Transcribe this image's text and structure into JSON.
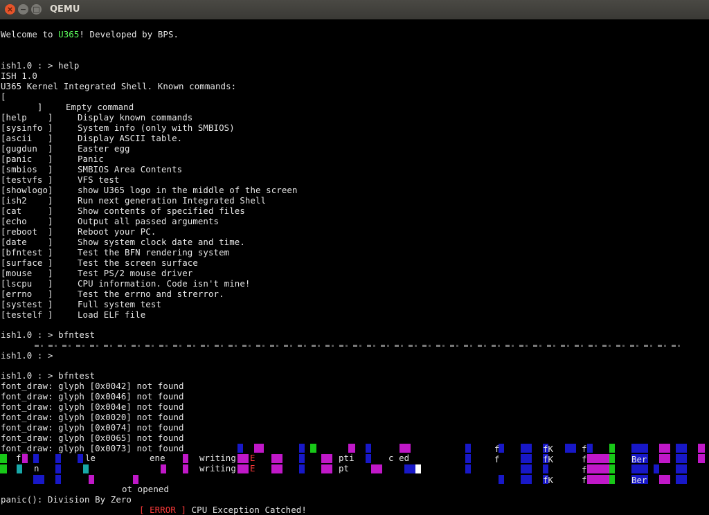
{
  "window": {
    "title": "QEMU"
  },
  "console": {
    "welcome": {
      "prefix": "Welcome to ",
      "brand": "U365",
      "suffix": "! Developed by BPS."
    },
    "prompt1": "ish1.0 : > help",
    "help_header": [
      "ISH 1.0",
      "U365 Kernel Integrated Shell. Known commands:"
    ],
    "empty_cmd": {
      "bracket_open": "[",
      "bracket_close": "       ]",
      "desc": "Empty command"
    },
    "commands": [
      {
        "cmd": "[help    ]",
        "desc": "Display known commands"
      },
      {
        "cmd": "[sysinfo ]",
        "desc": "System info (only with SMBIOS)"
      },
      {
        "cmd": "[ascii   ]",
        "desc": "Display ASCII table."
      },
      {
        "cmd": "[gugdun  ]",
        "desc": "Easter egg"
      },
      {
        "cmd": "[panic   ]",
        "desc": "Panic"
      },
      {
        "cmd": "[smbios  ]",
        "desc": "SMBIOS Area Contents"
      },
      {
        "cmd": "[testvfs ]",
        "desc": "VFS test"
      },
      {
        "cmd": "[showlogo]",
        "desc": "show U365 logo in the middle of the screen"
      },
      {
        "cmd": "[ish2    ]",
        "desc": "Run next generation Integrated Shell"
      },
      {
        "cmd": "[cat     ]",
        "desc": "Show contents of specified files"
      },
      {
        "cmd": "[echo    ]",
        "desc": "Output all passed arguments"
      },
      {
        "cmd": "[reboot  ]",
        "desc": "Reboot your PC."
      },
      {
        "cmd": "[date    ]",
        "desc": "Show system clock date and time."
      },
      {
        "cmd": "[bfntest ]",
        "desc": "Test the BFN rendering system"
      },
      {
        "cmd": "[surface ]",
        "desc": "Test the screen surface"
      },
      {
        "cmd": "[mouse   ]",
        "desc": "Test PS/2 mouse driver"
      },
      {
        "cmd": "[lscpu   ]",
        "desc": "CPU information. Code isn't mine!"
      },
      {
        "cmd": "[errno   ]",
        "desc": "Test the errno and strerror."
      },
      {
        "cmd": "[systest ]",
        "desc": "Full system test"
      },
      {
        "cmd": "[testelf ]",
        "desc": "Load ELF file"
      }
    ],
    "prompt2": "ish1.0 : > bfntest",
    "prompt3": "ish1.0 : >",
    "prompt4": "ish1.0 : > bfntest",
    "font_errors": [
      "font_draw: glyph [0x0042] not found",
      "font_draw: glyph [0x0046] not found",
      "font_draw: glyph [0x004e] not found",
      "font_draw: glyph [0x0020] not found",
      "font_draw: glyph [0x0074] not found",
      "font_draw: glyph [0x0065] not found",
      "font_draw: glyph [0x0073] not found"
    ],
    "garbled_fragments": {
      "row1_a": "f",
      "row1_b": "le",
      "row1_c": "ene",
      "row1_d": "writing",
      "row1_e": "E",
      "row1_f": "pti",
      "row1_g": "c ed",
      "row2_a": "n",
      "row2_b": "writing",
      "row2_c": "E",
      "row2_d": "pt",
      "fk": "fK",
      "f": "f",
      "ber": "Ber",
      "not_opened": "ot opened"
    },
    "panic": "panic(): Division By Zero",
    "error_tag": "[ ERROR ]",
    "error_msg": " CPU Exception Catched!"
  },
  "colors": {
    "prompt_green": "#5cff5c",
    "error_red": "#ff3a3a",
    "glitch_blue": "#1818c8",
    "glitch_magenta": "#c018c8",
    "glitch_green": "#18c818",
    "glitch_cyan": "#18a8a8"
  }
}
